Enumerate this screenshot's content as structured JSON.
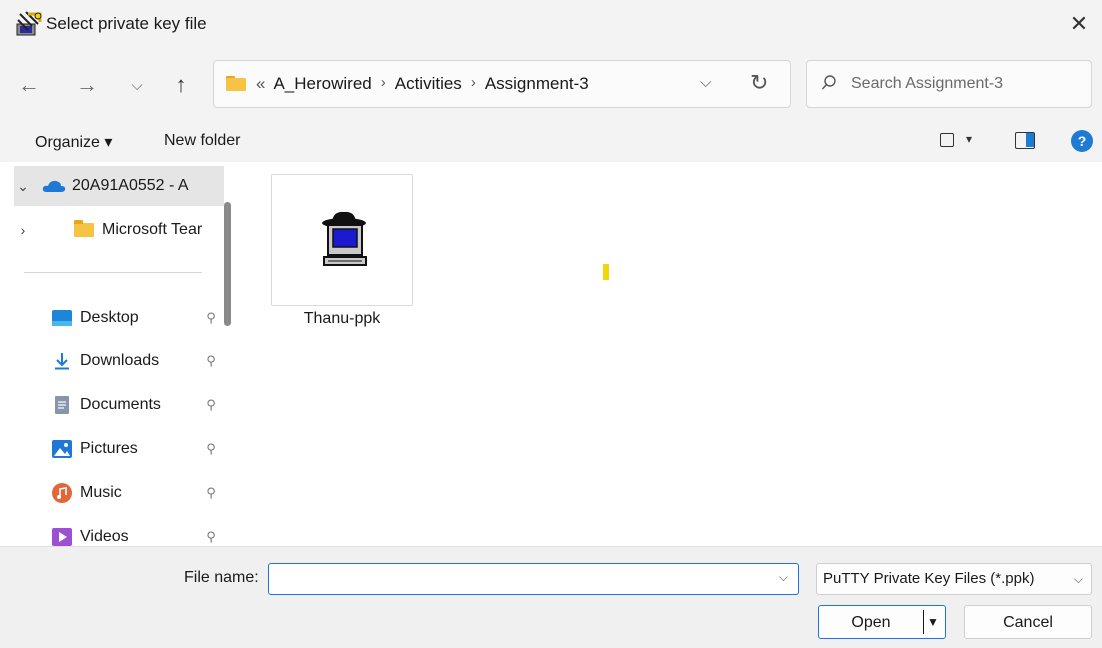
{
  "window": {
    "title": "Select private key file",
    "close_glyph": "✕",
    "icon": "putty-keygen-icon"
  },
  "nav": {
    "back_glyph": "←",
    "forward_glyph": "→",
    "recent_glyph": "⌵",
    "up_glyph": "↑",
    "address": {
      "overflow": "«",
      "crumbs": [
        "A_Herowired",
        "Activities",
        "Assignment-3"
      ],
      "separator": "›",
      "dropdown_glyph": "⌵",
      "refresh_glyph": "↻"
    },
    "search": {
      "placeholder": "Search Assignment-3"
    }
  },
  "toolbar": {
    "organize_label": "Organize ▾",
    "new_folder_label": "New folder",
    "view_drop_glyph": "▾",
    "help_glyph": "?"
  },
  "sidebar": {
    "tree": [
      {
        "label": "20A91A0552 - A",
        "chevron": "⌄",
        "icon": "onedrive-cloud-icon",
        "selected": true
      },
      {
        "label": "Microsoft Tear",
        "chevron": "›",
        "icon": "folder-icon",
        "selected": false
      }
    ],
    "quick_access": [
      {
        "label": "Desktop",
        "icon": "desktop-icon",
        "pin": "📌"
      },
      {
        "label": "Downloads",
        "icon": "downloads-icon",
        "pin": "📌"
      },
      {
        "label": "Documents",
        "icon": "documents-icon",
        "pin": "📌"
      },
      {
        "label": "Pictures",
        "icon": "pictures-icon",
        "pin": "📌"
      },
      {
        "label": "Music",
        "icon": "music-icon",
        "pin": "📌"
      },
      {
        "label": "Videos",
        "icon": "videos-icon",
        "pin": "📌"
      }
    ]
  },
  "files": [
    {
      "name": "Thanu-ppk",
      "icon": "putty-ppk-file-icon"
    }
  ],
  "footer": {
    "file_name_label": "File name:",
    "file_name_value": "",
    "file_name_drop_glyph": "⌵",
    "filter_value": "PuTTY Private Key Files (*.ppk)",
    "filter_drop_glyph": "⌵",
    "open_label": "Open",
    "open_split_glyph": "▼",
    "cancel_label": "Cancel"
  },
  "colors": {
    "accent": "#1a73e8",
    "folder": "#f6c344",
    "onedrive": "#1e78d4",
    "selection": "#e5e5e5"
  }
}
